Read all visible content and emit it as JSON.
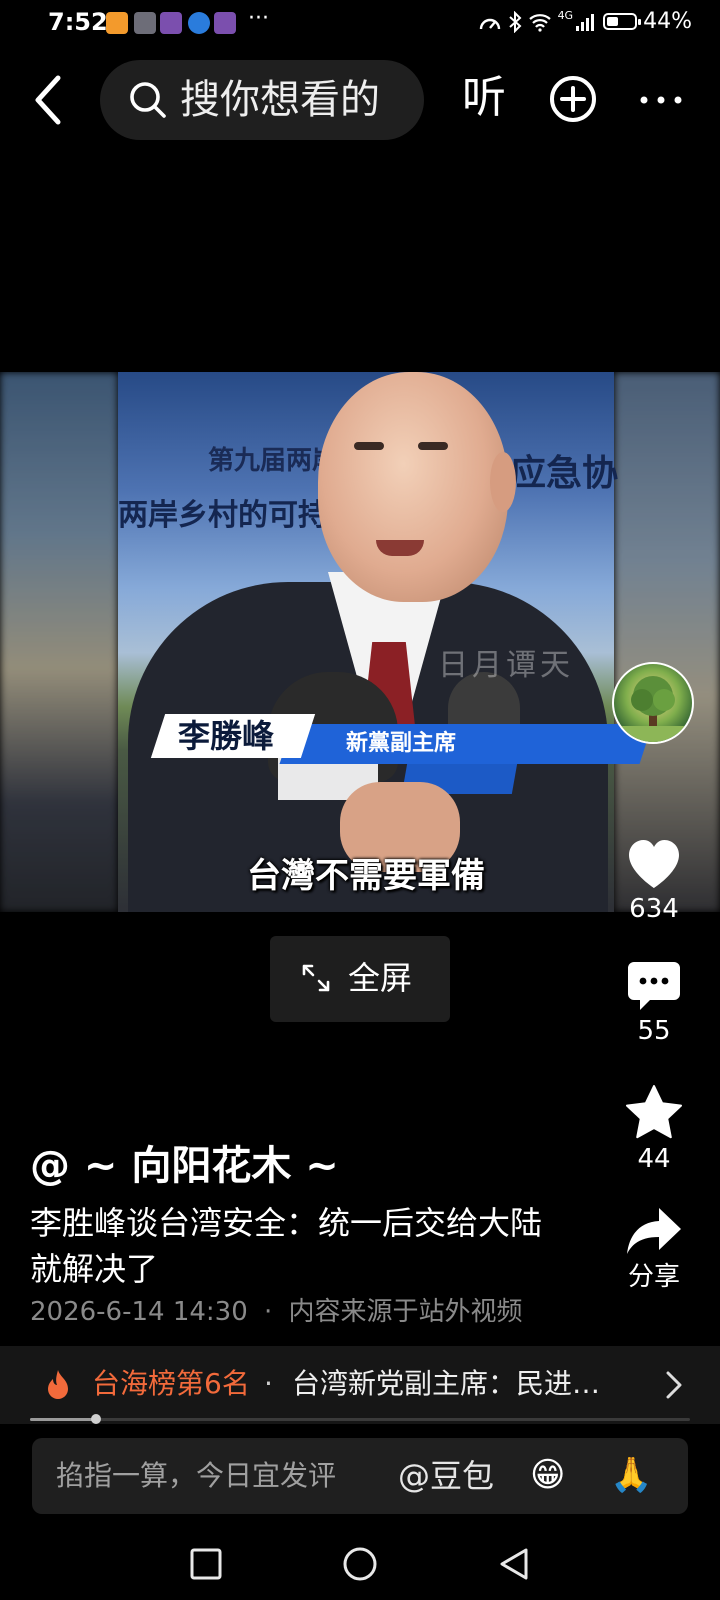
{
  "status_bar": {
    "time": "7:52",
    "more": "···",
    "network": "4G",
    "battery_percent": "44%",
    "battery_level": 0.44
  },
  "header": {
    "back_icon": "chevron-left-icon",
    "search_placeholder": "搜你想看的",
    "listen_label": "听",
    "add_icon": "plus-circle-icon",
    "more_icon": "more-horizontal-icon"
  },
  "video": {
    "board_line1": "第九届两岸",
    "board_line2": "两岸乡村的可持",
    "board_line3": "应急协",
    "watermark": "日月谭天",
    "name_caption": "李勝峰",
    "title_caption": "新黨副主席",
    "subtitle": "台灣不需要軍備"
  },
  "fullscreen": {
    "label": "全屏",
    "icon": "expand-icon"
  },
  "actions": {
    "like_count": "634",
    "comment_count": "55",
    "favorite_count": "44",
    "share_label": "分享"
  },
  "post": {
    "author": "@ ~ 向阳花木 ~",
    "description": "李胜峰谈台湾安全：统一后交给大陆就解决了",
    "timestamp": "2026-6-14 14:30",
    "separator": "·",
    "source_note": "内容来源于站外视频"
  },
  "hot_bar": {
    "rank_label": "台海榜第6名",
    "dot": "·",
    "title": "台湾新党副主席：民进…"
  },
  "progress": {
    "fraction": 0.1
  },
  "comment_bar": {
    "placeholder": "掐指一算，今日宜发评",
    "mention_label": "@豆包",
    "emoji_1": "😁",
    "emoji_2": "🙏"
  },
  "colors": {
    "background": "#000000",
    "hot_accent": "#f26a3b",
    "caption_blue": "#1f63d8"
  }
}
